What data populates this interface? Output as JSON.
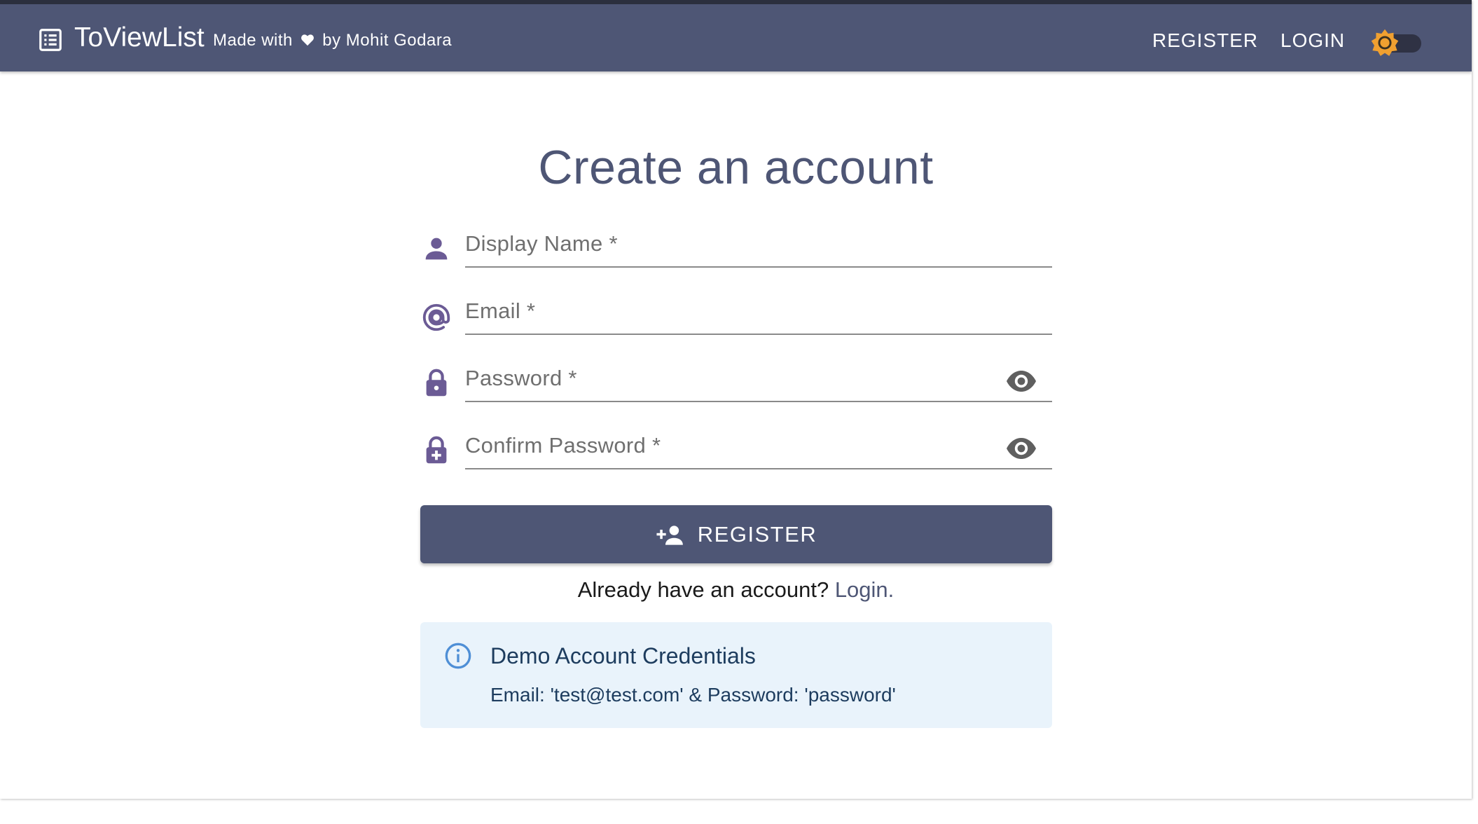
{
  "header": {
    "brand_title": "ToViewList",
    "made_with": "Made with",
    "by_author": "by Mohit Godara",
    "nav": {
      "register": "REGISTER",
      "login": "LOGIN"
    },
    "icons": {
      "brand": "list-icon",
      "heart": "heart-icon",
      "theme": "sun-icon"
    },
    "theme_toggle_on": false
  },
  "form": {
    "title": "Create an account",
    "fields": [
      {
        "label": "Display Name *",
        "icon": "person-icon",
        "value": ""
      },
      {
        "label": "Email *",
        "icon": "at-icon",
        "value": ""
      },
      {
        "label": "Password *",
        "icon": "lock-icon",
        "value": "",
        "visibility_toggle": true
      },
      {
        "label": "Confirm Password *",
        "icon": "lock-plus-icon",
        "value": "",
        "visibility_toggle": true
      }
    ],
    "submit_label": "REGISTER",
    "submit_icon": "person-add-icon",
    "login_prompt": "Already have an account?",
    "login_link": "Login."
  },
  "info": {
    "title": "Demo Account Credentials",
    "body": "Email: 'test@test.com' & Password: 'password'",
    "icon": "info-icon"
  },
  "colors": {
    "header_bg": "#4e5675",
    "accent": "#4e5675",
    "field_icon": "#6b5b95",
    "sun": "#f0a030",
    "info_bg": "#e9f3fb",
    "info_text": "#1d3c5e",
    "info_icon": "#4f8fd6"
  }
}
